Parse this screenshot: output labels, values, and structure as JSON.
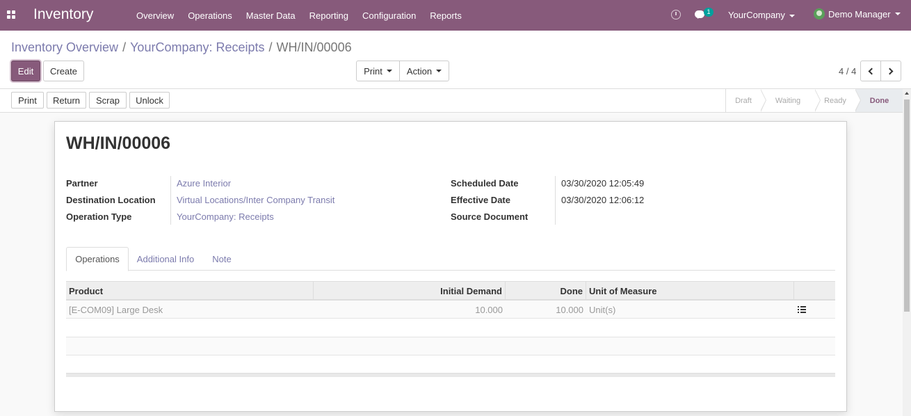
{
  "navbar": {
    "app_title": "Inventory",
    "menu": [
      "Overview",
      "Operations",
      "Master Data",
      "Reporting",
      "Configuration",
      "Reports"
    ],
    "chat_badge": "1",
    "company": "YourCompany",
    "user": "Demo Manager"
  },
  "breadcrumb": {
    "items": [
      "Inventory Overview",
      "YourCompany: Receipts"
    ],
    "current": "WH/IN/00006"
  },
  "toolbar": {
    "edit": "Edit",
    "create": "Create",
    "print": "Print",
    "action": "Action",
    "pager": "4 / 4"
  },
  "header_buttons": [
    "Print",
    "Return",
    "Scrap",
    "Unlock"
  ],
  "statusbar": {
    "stages": [
      "Draft",
      "Waiting",
      "Ready",
      "Done"
    ],
    "current": "Done"
  },
  "record": {
    "name": "WH/IN/00006",
    "left_fields": [
      {
        "label": "Partner",
        "value": "Azure Interior"
      },
      {
        "label": "Destination Location",
        "value": "Virtual Locations/Inter Company Transit"
      },
      {
        "label": "Operation Type",
        "value": "YourCompany: Receipts"
      }
    ],
    "right_fields": [
      {
        "label": "Scheduled Date",
        "value": "03/30/2020 12:05:49"
      },
      {
        "label": "Effective Date",
        "value": "03/30/2020 12:06:12"
      },
      {
        "label": "Source Document",
        "value": ""
      }
    ]
  },
  "tabs": [
    "Operations",
    "Additional Info",
    "Note"
  ],
  "operations_table": {
    "columns": [
      "Product",
      "Initial Demand",
      "Done",
      "Unit of Measure"
    ],
    "rows": [
      {
        "product": "[E-COM09] Large Desk",
        "initial_demand": "10.000",
        "done": "10.000",
        "uom": "Unit(s)"
      }
    ]
  },
  "colors": {
    "brand": "#875a7b",
    "link": "#7c7bad"
  }
}
